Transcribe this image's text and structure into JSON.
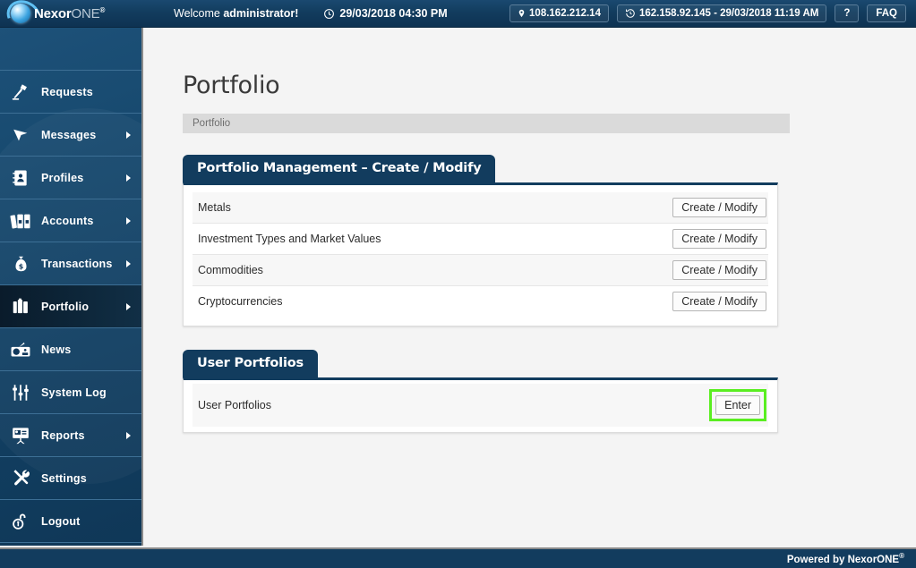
{
  "header": {
    "logo_nexor": "Nexor",
    "logo_one": "ONE",
    "logo_reg": "®",
    "welcome_prefix": "Welcome ",
    "welcome_user": "administrator!",
    "datetime": "29/03/2018 04:30 PM",
    "ip_badge": "108.162.212.14",
    "last_login_badge": "162.158.92.145 - 29/03/2018 11:19 AM",
    "help_label": "?",
    "faq_label": "FAQ"
  },
  "sidebar": {
    "items": [
      {
        "label": "Requests",
        "icon": "desk-lamp-icon",
        "arrow": false,
        "active": false
      },
      {
        "label": "Messages",
        "icon": "cursor-arrow-icon",
        "arrow": true,
        "active": false
      },
      {
        "label": "Profiles",
        "icon": "address-book-icon",
        "arrow": true,
        "active": false
      },
      {
        "label": "Accounts",
        "icon": "binders-icon",
        "arrow": true,
        "active": false
      },
      {
        "label": "Transactions",
        "icon": "money-bag-icon",
        "arrow": true,
        "active": false
      },
      {
        "label": "Portfolio",
        "icon": "briefcase-icon",
        "arrow": true,
        "active": true
      },
      {
        "label": "News",
        "icon": "radio-icon",
        "arrow": false,
        "active": false
      },
      {
        "label": "System Log",
        "icon": "sliders-icon",
        "arrow": false,
        "active": false
      },
      {
        "label": "Reports",
        "icon": "presentation-icon",
        "arrow": true,
        "active": false
      },
      {
        "label": "Settings",
        "icon": "tools-icon",
        "arrow": false,
        "active": false
      },
      {
        "label": "Logout",
        "icon": "unlocked-padlock-icon",
        "arrow": false,
        "active": false
      }
    ]
  },
  "main": {
    "page_title": "Portfolio",
    "breadcrumb": "Portfolio",
    "panels": [
      {
        "tab_title": "Portfolio Management – Create / Modify",
        "rows": [
          {
            "label": "Metals",
            "action": "Create / Modify"
          },
          {
            "label": "Investment Types and Market Values",
            "action": "Create / Modify"
          },
          {
            "label": "Commodities",
            "action": "Create / Modify"
          },
          {
            "label": "Cryptocurrencies",
            "action": "Create / Modify"
          }
        ]
      },
      {
        "tab_title": "User Portfolios",
        "rows": [
          {
            "label": "User Portfolios",
            "action": "Enter"
          }
        ]
      }
    ]
  },
  "footer": {
    "powered_by": "Powered by NexorONE",
    "reg": "®"
  },
  "colors": {
    "header_navy": "#123c5e",
    "sidebar_blue": "#17496e",
    "accent_navy": "#123c5e",
    "highlight_green": "#5aee21",
    "page_bg": "#f4f4f4",
    "breadcrumb_bg": "#dadada"
  }
}
